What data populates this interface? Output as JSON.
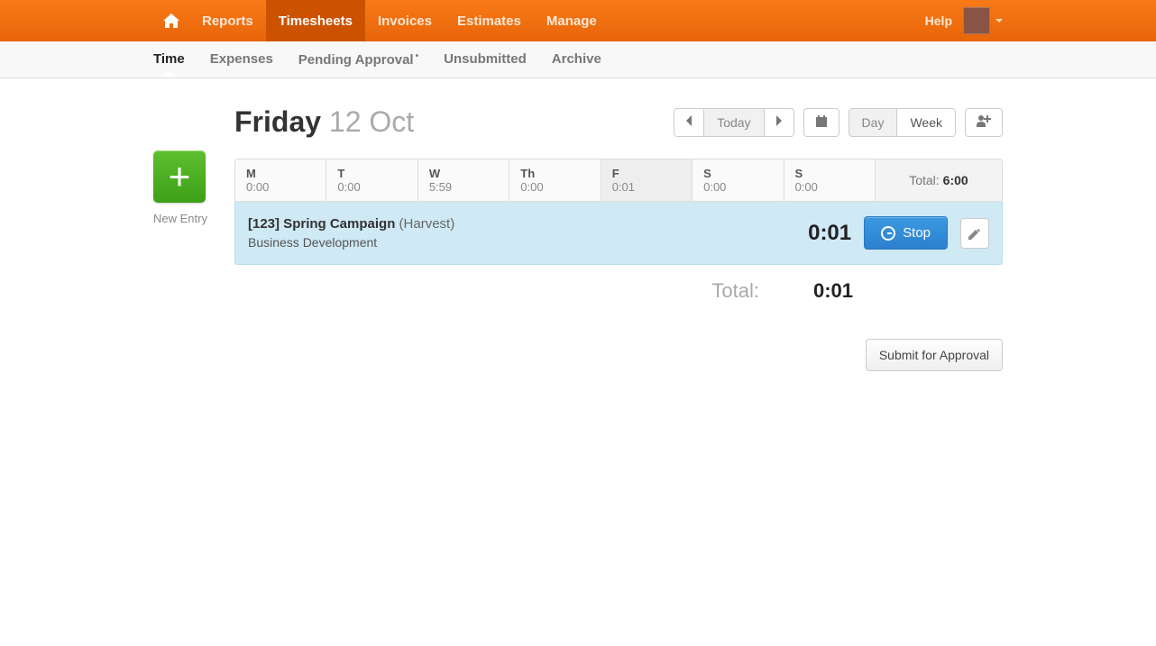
{
  "topnav": {
    "items": [
      "Reports",
      "Timesheets",
      "Invoices",
      "Estimates",
      "Manage"
    ],
    "active_index": 1,
    "help": "Help"
  },
  "subnav": {
    "items": [
      "Time",
      "Expenses",
      "Pending Approval",
      "Unsubmitted",
      "Archive"
    ],
    "active_index": 0,
    "badge_index": 2
  },
  "heading": {
    "day_name": "Friday",
    "date": "12 Oct"
  },
  "controls": {
    "today": "Today",
    "day": "Day",
    "week": "Week"
  },
  "new_entry": {
    "label": "New Entry"
  },
  "week": {
    "days": [
      {
        "abbr": "M",
        "hours": "0:00"
      },
      {
        "abbr": "T",
        "hours": "0:00"
      },
      {
        "abbr": "W",
        "hours": "5:59"
      },
      {
        "abbr": "Th",
        "hours": "0:00"
      },
      {
        "abbr": "F",
        "hours": "0:01"
      },
      {
        "abbr": "S",
        "hours": "0:00"
      },
      {
        "abbr": "S",
        "hours": "0:00"
      }
    ],
    "selected_index": 4,
    "total_label": "Total:",
    "total_value": "6:00"
  },
  "entry": {
    "project": "[123] Spring Campaign",
    "client": "(Harvest)",
    "task": "Business Development",
    "time": "0:01",
    "stop": "Stop"
  },
  "footer": {
    "total_label": "Total:",
    "total_value": "0:01",
    "submit": "Submit for Approval"
  }
}
